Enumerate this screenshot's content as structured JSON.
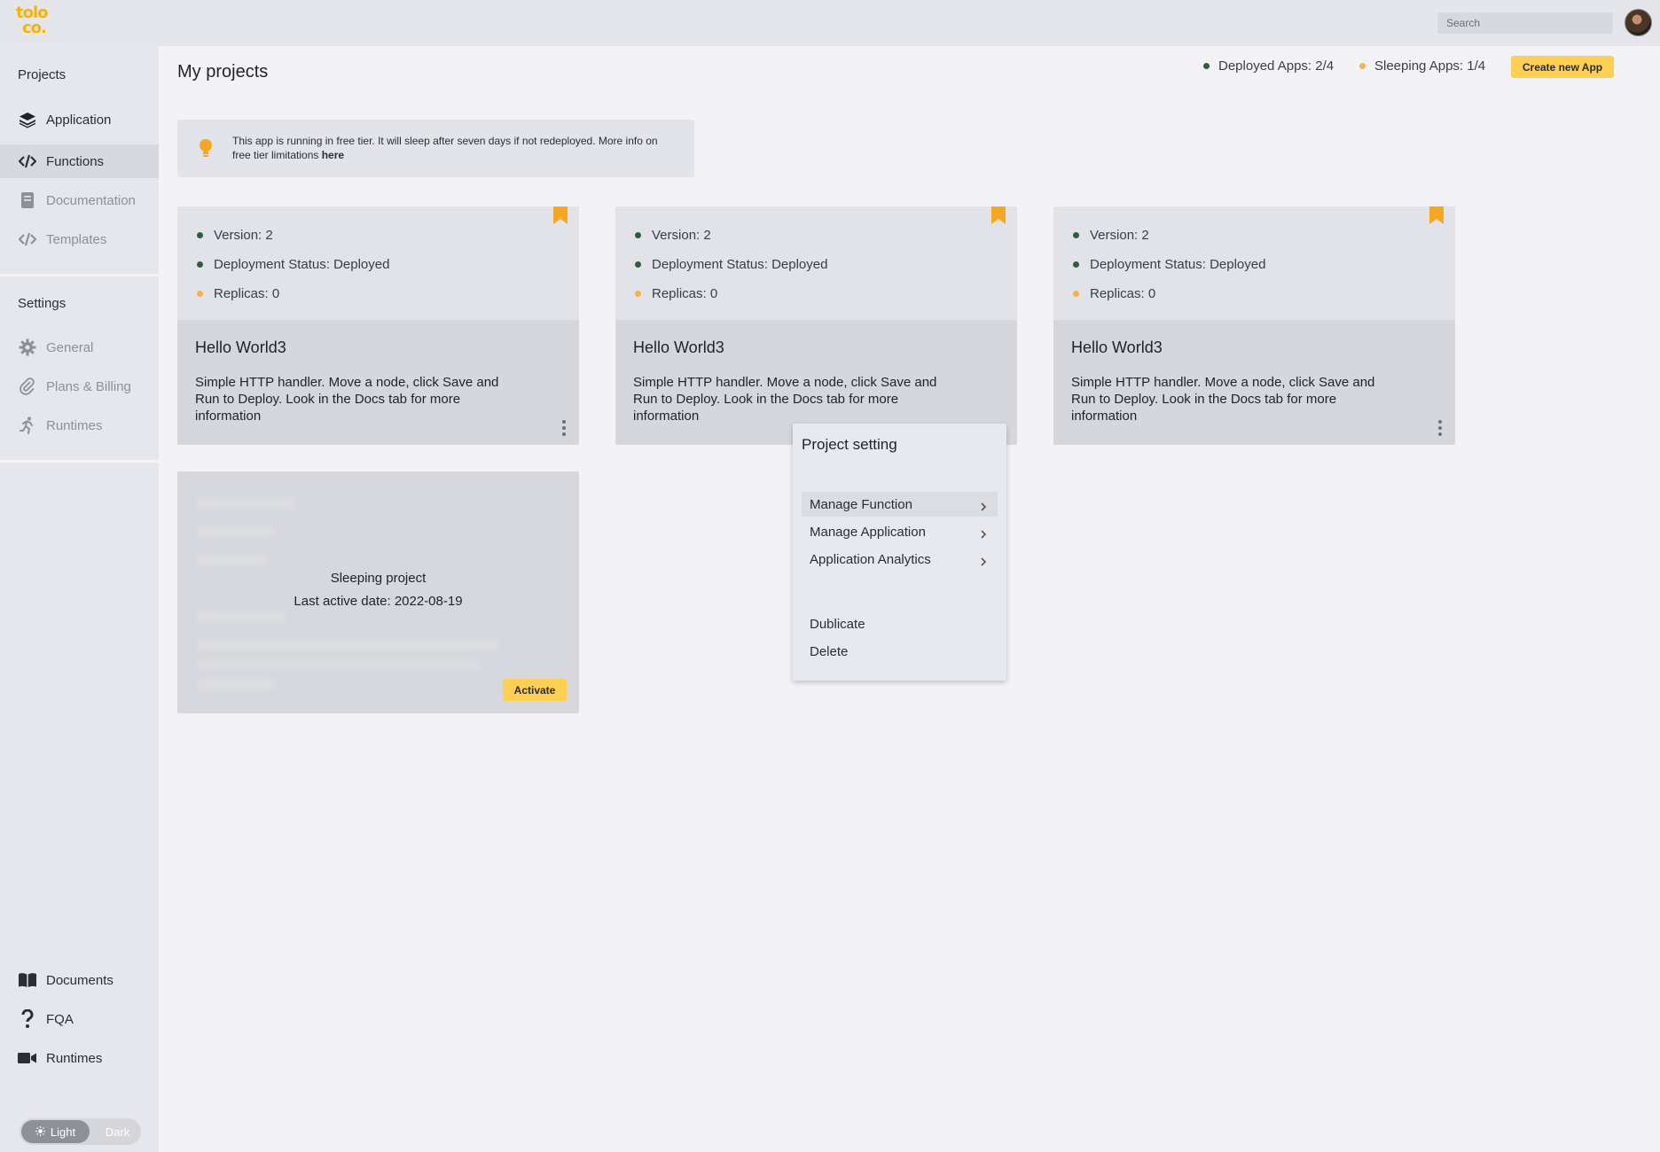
{
  "header": {
    "logo_line1": "tolo",
    "logo_line2": "co.",
    "search_placeholder": "Search"
  },
  "sidebar": {
    "projects_title": "Projects",
    "project_items": [
      {
        "label": "Application",
        "icon": "layers-icon"
      },
      {
        "label": "Functions",
        "icon": "code-icon"
      },
      {
        "label": "Documentation",
        "icon": "book-icon"
      },
      {
        "label": "Templates",
        "icon": "code-icon"
      }
    ],
    "settings_title": "Settings",
    "settings_items": [
      {
        "label": "General",
        "icon": "gear-icon"
      },
      {
        "label": "Plans & Billing",
        "icon": "paperclip-icon"
      },
      {
        "label": "Runtimes",
        "icon": "runner-icon"
      }
    ],
    "bottom_items": [
      {
        "label": "Documents",
        "icon": "open-book-icon"
      },
      {
        "label": "FQA",
        "icon": "question-icon"
      },
      {
        "label": "Runtimes",
        "icon": "video-camera-icon"
      }
    ],
    "theme": {
      "light": "Light",
      "dark": "Dark"
    }
  },
  "main": {
    "title": "My projects",
    "deployed_apps": "Deployed Apps: 2/4",
    "sleeping_apps": "Sleeping Apps: 1/4",
    "create_button": "Create new App",
    "banner": {
      "text": "This app is running in free tier. It will sleep after seven days if not redeployed. More info on free tier limitations ",
      "link": "here"
    },
    "cards": [
      {
        "version": "Version: 2",
        "status": "Deployment Status: Deployed",
        "replicas": "Replicas: 0",
        "title": "Hello World3",
        "description": "Simple HTTP handler. Move a node, click Save and Run to Deploy. Look in the Docs tab for more information"
      },
      {
        "version": "Version: 2",
        "status": "Deployment Status: Deployed",
        "replicas": "Replicas: 0",
        "title": "Hello World3",
        "description": "Simple HTTP handler. Move a node, click Save and Run to Deploy. Look in the Docs tab for more information"
      },
      {
        "version": "Version: 2",
        "status": "Deployment Status: Deployed",
        "replicas": "Replicas: 0",
        "title": "Hello World3",
        "description": "Simple HTTP handler. Move a node, click Save and Run to Deploy. Look in the Docs tab for more information"
      }
    ],
    "sleeping_card": {
      "title": "Sleeping project",
      "last_active": "Last active date: 2022-08-19",
      "activate_button": "Activate"
    },
    "context_menu": {
      "title": "Project setting",
      "items": [
        "Manage Function",
        "Manage Application",
        "Application Analytics"
      ],
      "actions": [
        "Dublicate",
        "Delete"
      ]
    }
  },
  "colors": {
    "accent": "#fdcf55",
    "bookmark": "#f5a623",
    "deployed_dot": "#2f5d3a",
    "sleeping_dot": "#f6b24a"
  }
}
